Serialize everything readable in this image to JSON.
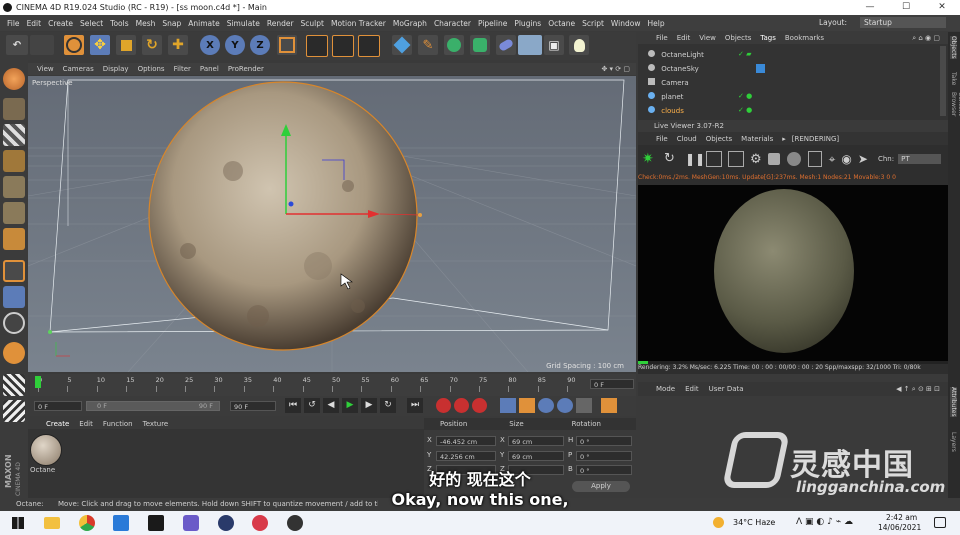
{
  "window": {
    "title": "CINEMA 4D R19.024 Studio (RC - R19) - [ss moon.c4d *] - Main",
    "min": "—",
    "max": "☐",
    "close": "✕"
  },
  "menu": [
    "File",
    "Edit",
    "Create",
    "Select",
    "Tools",
    "Mesh",
    "Snap",
    "Animate",
    "Simulate",
    "Render",
    "Sculpt",
    "Motion Tracker",
    "MoGraph",
    "Character",
    "Pipeline",
    "Plugins",
    "Octane",
    "Script",
    "Window",
    "Help"
  ],
  "layout": {
    "label": "Layout:",
    "value": "Startup"
  },
  "toolbar": {
    "x": "X",
    "y": "Y",
    "z": "Z"
  },
  "viewport": {
    "menu": [
      "View",
      "Cameras",
      "Display",
      "Options",
      "Filter",
      "Panel",
      "ProRender"
    ],
    "label": "Perspective",
    "grid_spacing": "Grid Spacing : 100 cm"
  },
  "timeline": {
    "ticks": [
      "0",
      "5",
      "10",
      "15",
      "20",
      "25",
      "30",
      "35",
      "40",
      "45",
      "50",
      "55",
      "60",
      "65",
      "70",
      "75",
      "80",
      "85",
      "90"
    ],
    "current_frame": "0 F",
    "start": "0 F",
    "min": "0 F",
    "max": "90 F",
    "end": "90 F"
  },
  "material_manager": {
    "menu": [
      "Create",
      "Edit",
      "Function",
      "Texture"
    ],
    "material_name": "Octane"
  },
  "coordinates": {
    "headers": [
      "Position",
      "Size",
      "Rotation"
    ],
    "rows": [
      {
        "axis": "X",
        "pos": "-46.452 cm",
        "size_axis": "X",
        "size": "69 cm",
        "rot_axis": "H",
        "rot": "0 °"
      },
      {
        "axis": "Y",
        "pos": "42.256 cm",
        "size_axis": "Y",
        "size": "69 cm",
        "rot_axis": "P",
        "rot": "0 °"
      },
      {
        "axis": "Z",
        "pos": "",
        "size_axis": "Z",
        "size": "",
        "rot_axis": "B",
        "rot": "0 °"
      }
    ],
    "apply": "Apply"
  },
  "object_manager": {
    "menu": [
      "File",
      "Edit",
      "View",
      "Objects",
      "Tags",
      "Bookmarks"
    ],
    "objects": [
      "OctaneLight",
      "OctaneSky",
      "Camera",
      "planet",
      "clouds"
    ]
  },
  "live_viewer": {
    "title": "Live Viewer 3.07-R2",
    "menu": [
      "File",
      "Cloud",
      "Objects",
      "Materials",
      "▸",
      "[RENDERING]"
    ],
    "channel_label": "Chn:",
    "channel_value": "PT",
    "stats": "Check:0ms./2ms. MeshGen:10ms. Update[G]:237ms. Mesh:1 Nodes:21 Movable:3 0 0",
    "status": "Rendering: 3.2%   Ms/sec: 6.225   Time: 00 : 00 : 00/00 : 00 : 20   Spp/maxspp: 32/1000   Tri: 0/80k"
  },
  "attributes": {
    "menu": [
      "Mode",
      "Edit",
      "User Data"
    ]
  },
  "right_tabs": [
    "Objects",
    "Take",
    "Content Browser",
    "Attributes",
    "Layers"
  ],
  "status_bar": {
    "label": "Octane:",
    "message": "Move: Click and drag to move elements. Hold down SHIFT to quantize movement / add to the selection in point mode, CTRL to remove."
  },
  "brand": {
    "maxon": "MAXON",
    "cinema": "CINEMA 4D"
  },
  "subtitles": {
    "zh": "好的 现在这个",
    "en": "Okay, now this one,"
  },
  "watermark": {
    "cn": "灵感中国",
    "url": "lingganchina.com"
  },
  "taskbar": {
    "weather": "34°C  Haze",
    "time": "2:42 am",
    "date": "14/06/2021"
  },
  "colors": {
    "accent_orange": "#d8862a",
    "axis_red": "#e23030",
    "axis_green": "#2fcf3a",
    "axis_blue": "#2a4ad8"
  }
}
